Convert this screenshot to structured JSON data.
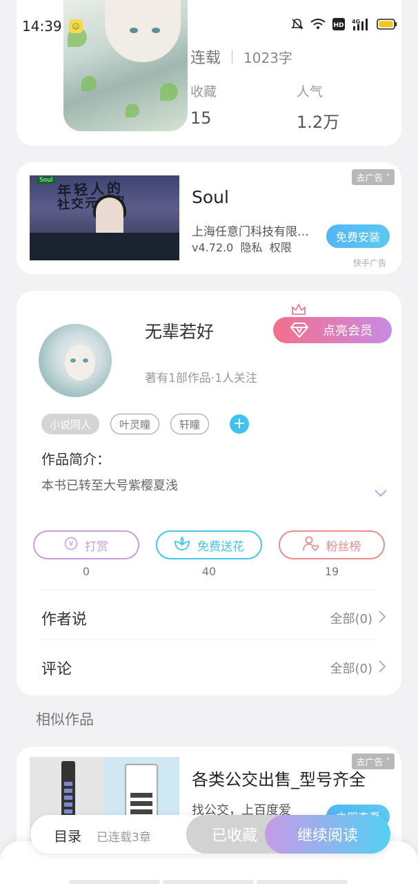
{
  "status_bar": {
    "time": "14:39",
    "icons": [
      "app-notification-icon",
      "bell-muted-icon",
      "wifi-icon",
      "hd-icon",
      "signal-4g-icon",
      "battery-icon"
    ]
  },
  "book": {
    "status": "连载",
    "word_count": "1023字",
    "favorites_label": "收藏",
    "favorites_value": "15",
    "popularity_label": "人气",
    "popularity_value": "1.2万"
  },
  "ad": {
    "close_label": "去广告",
    "title": "Soul",
    "company": "上海任意门科技有限公司",
    "version": "v4.72.0",
    "privacy": "隐私",
    "permissions": "权限",
    "install_label": "免费安装",
    "source": "快手广告",
    "image_text_line1": "年轻人的",
    "image_text_line2": "社交元宇宙",
    "image_logo": "Soul"
  },
  "author": {
    "name": "无辈若好",
    "info": "著有1部作品·1人关注",
    "vip_label": "点亮会员",
    "tags": [
      "小说同人",
      "叶灵瞳",
      "轩瞳"
    ],
    "intro_label": "作品简介：",
    "intro_text": "本书已转至大号紫樱夏浅",
    "actions": [
      {
        "label": "打赏",
        "count": "0"
      },
      {
        "label": "免费送花",
        "count": "40"
      },
      {
        "label": "粉丝榜",
        "count": "19"
      }
    ],
    "author_says_label": "作者说",
    "author_says_right": "全部(0)",
    "comments_label": "评论",
    "comments_right": "全部(0)"
  },
  "similar": {
    "title": "相似作品",
    "ad_close_label": "去广告",
    "ad_title": "各类公交出售_型号齐全",
    "ad_desc": "找公交，上百度爱",
    "ad_install_label": "立即查看"
  },
  "bottom_bar": {
    "toc_label": "目录",
    "toc_sub": "已连载3章",
    "collected_label": "已收藏",
    "read_label": "继续阅读"
  },
  "colors": {
    "accent_purple": "#c99be0",
    "accent_cyan": "#3fc8e8",
    "accent_red": "#ec8c8c",
    "install_blue": "#52b6f5"
  }
}
